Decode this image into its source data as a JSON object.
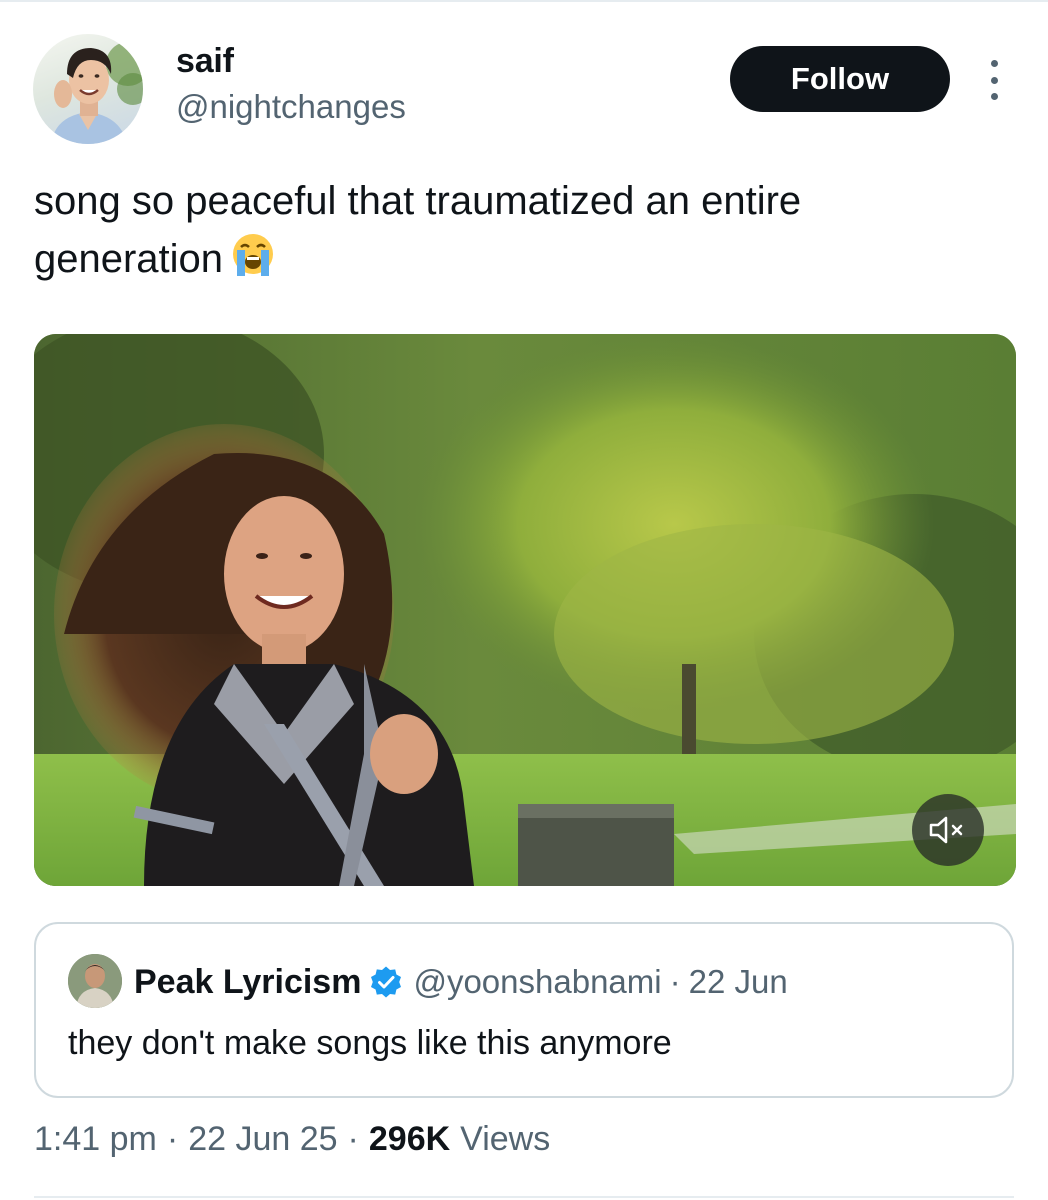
{
  "author": {
    "display_name": "saif",
    "handle": "@nightchanges",
    "avatar": "profile-photo-man-smiling"
  },
  "follow_label": "Follow",
  "more_icon": "more-vertical-icon",
  "tweet": {
    "text": "song so peaceful that traumatized an entire generation",
    "emoji": "loudly-crying-face"
  },
  "media": {
    "type": "video-still",
    "subject": "woman-running-in-park",
    "mute_icon": "speaker-muted-icon"
  },
  "quoted": {
    "display_name": "Peak Lyricism",
    "verified": true,
    "verified_icon": "verified-badge-icon",
    "handle": "@yoonshabnami",
    "separator": "·",
    "date": "22 Jun",
    "text": "they don't make songs like this anymore"
  },
  "meta": {
    "time": "1:41 pm",
    "separator": "·",
    "date": "22 Jun 25",
    "views_count": "296K",
    "views_label": "Views"
  },
  "colors": {
    "primary_text": "#0f1419",
    "secondary_text": "#536471",
    "border": "#cfd9de",
    "button_bg": "#0f1419",
    "verified_blue": "#1d9bf0"
  }
}
